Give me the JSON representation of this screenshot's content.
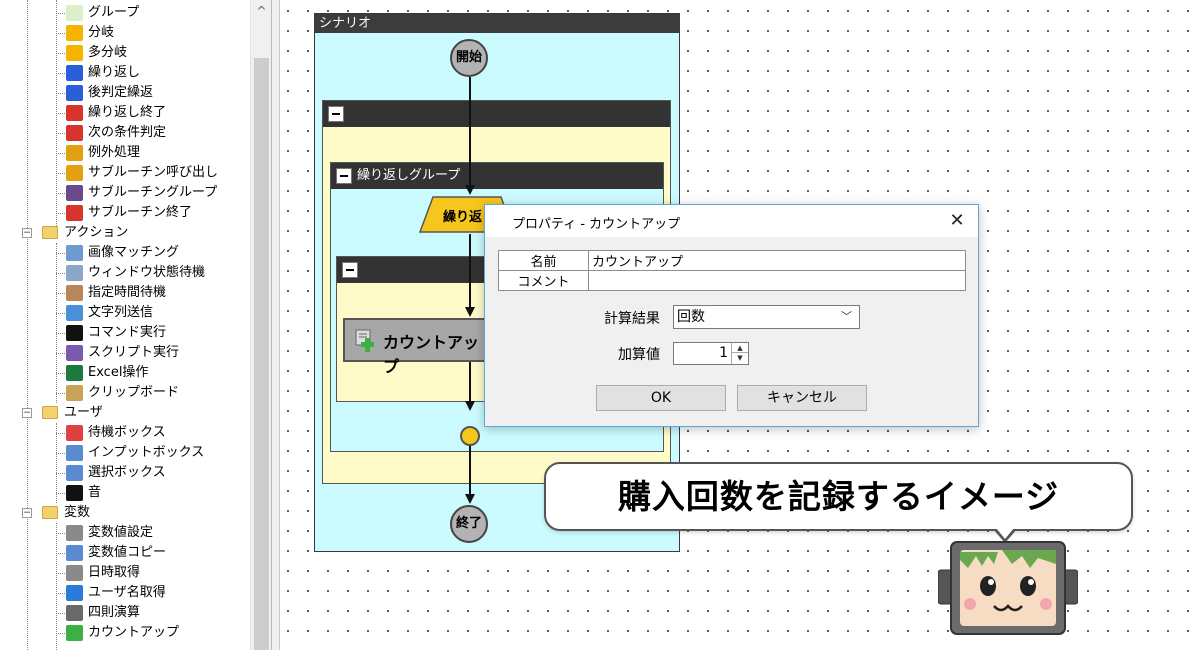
{
  "tree": {
    "items": [
      {
        "kind": "child",
        "label": "グループ",
        "icon": "group-icon",
        "color": "#d9f0c8"
      },
      {
        "kind": "child",
        "label": "分岐",
        "icon": "branch-icon",
        "color": "#f5b400"
      },
      {
        "kind": "child",
        "label": "多分岐",
        "icon": "multi-branch-icon",
        "color": "#f5b400"
      },
      {
        "kind": "child",
        "label": "繰り返し",
        "icon": "loop-icon",
        "color": "#2b5fd9"
      },
      {
        "kind": "child",
        "label": "後判定繰返",
        "icon": "post-loop-icon",
        "color": "#2b5fd9"
      },
      {
        "kind": "child",
        "label": "繰り返し終了",
        "icon": "loop-end-icon",
        "color": "#d9342b"
      },
      {
        "kind": "child",
        "label": "次の条件判定",
        "icon": "next-condition-icon",
        "color": "#d9342b"
      },
      {
        "kind": "child",
        "label": "例外処理",
        "icon": "exception-icon",
        "color": "#e3a010"
      },
      {
        "kind": "child",
        "label": "サブルーチン呼び出し",
        "icon": "subroutine-call-icon",
        "color": "#e3a010"
      },
      {
        "kind": "child",
        "label": "サブルーチングループ",
        "icon": "subroutine-group-icon",
        "color": "#6a4a8c"
      },
      {
        "kind": "child",
        "label": "サブルーチン終了",
        "icon": "subroutine-end-icon",
        "color": "#d9342b"
      },
      {
        "kind": "cat",
        "label": "アクション"
      },
      {
        "kind": "child",
        "label": "画像マッチング",
        "icon": "image-match-icon",
        "color": "#6b9bd1"
      },
      {
        "kind": "child",
        "label": "ウィンドウ状態待機",
        "icon": "window-wait-icon",
        "color": "#8aa7c8"
      },
      {
        "kind": "child",
        "label": "指定時間待機",
        "icon": "hourglass-icon",
        "color": "#b9865a"
      },
      {
        "kind": "child",
        "label": "文字列送信",
        "icon": "keyboard-icon",
        "color": "#4a90d9"
      },
      {
        "kind": "child",
        "label": "コマンド実行",
        "icon": "command-icon",
        "color": "#111111"
      },
      {
        "kind": "child",
        "label": "スクリプト実行",
        "icon": "script-icon",
        "color": "#7a5ab0"
      },
      {
        "kind": "child",
        "label": "Excel操作",
        "icon": "excel-icon",
        "color": "#1e7a3c"
      },
      {
        "kind": "child",
        "label": "クリップボード",
        "icon": "clipboard-icon",
        "color": "#c9a25a"
      },
      {
        "kind": "cat",
        "label": "ユーザ"
      },
      {
        "kind": "child",
        "label": "待機ボックス",
        "icon": "wait-box-icon",
        "color": "#e04040"
      },
      {
        "kind": "child",
        "label": "インプットボックス",
        "icon": "input-box-icon",
        "color": "#5a8ad0"
      },
      {
        "kind": "child",
        "label": "選択ボックス",
        "icon": "select-box-icon",
        "color": "#5a8ad0"
      },
      {
        "kind": "child",
        "label": "音",
        "icon": "music-note-icon",
        "color": "#111111"
      },
      {
        "kind": "cat",
        "label": "変数"
      },
      {
        "kind": "child",
        "label": "変数値設定",
        "icon": "variable-set-icon",
        "color": "#8a8a8a"
      },
      {
        "kind": "child",
        "label": "変数値コピー",
        "icon": "variable-copy-icon",
        "color": "#5a8ad0"
      },
      {
        "kind": "child",
        "label": "日時取得",
        "icon": "clock-icon",
        "color": "#8a8a8a"
      },
      {
        "kind": "child",
        "label": "ユーザ名取得",
        "icon": "user-icon",
        "color": "#2b7bd9"
      },
      {
        "kind": "child",
        "label": "四則演算",
        "icon": "calculator-icon",
        "color": "#6a6a6a"
      },
      {
        "kind": "child",
        "label": "カウントアップ",
        "icon": "count-up-icon",
        "color": "#3cb043"
      }
    ],
    "scroll_up": "^"
  },
  "scenario": {
    "title": "シナリオ",
    "start_label": "開始",
    "end_label": "終了",
    "loop_group_title": "繰り返しグループ",
    "loop_start_label": "繰り返",
    "countup_label": "カウントアップ"
  },
  "dialog": {
    "title": "プロパティ - カウントアップ",
    "close": "✕",
    "rows": [
      {
        "key": "名前",
        "value": "カウントアップ"
      },
      {
        "key": "コメント",
        "value": ""
      }
    ],
    "calc_label": "計算結果",
    "calc_value": "回数",
    "add_label": "加算値",
    "add_value": "1",
    "ok": "OK",
    "cancel": "キャンセル"
  },
  "caption": "購入回数を記録するイメージ"
}
